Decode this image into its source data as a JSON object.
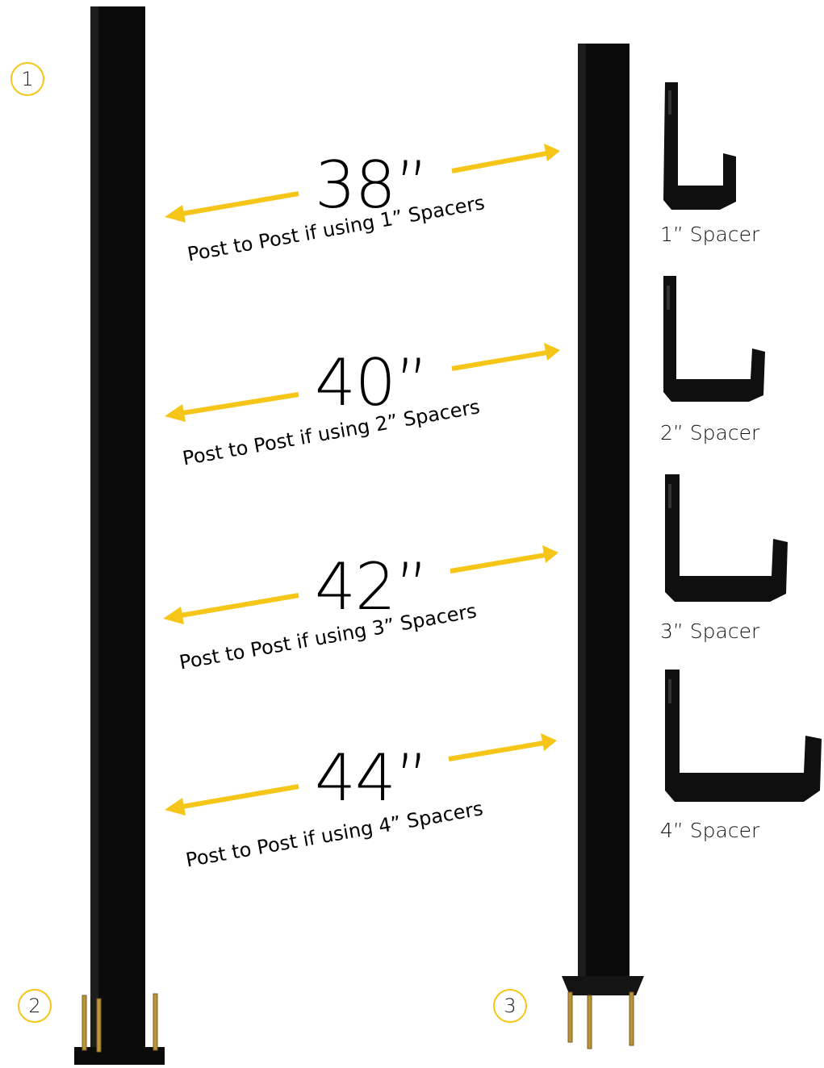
{
  "badges": {
    "b1": "1",
    "b2": "2",
    "b3": "3"
  },
  "measurements": [
    {
      "value": "38”",
      "caption": "Post to Post if using 1” Spacers"
    },
    {
      "value": "40”",
      "caption": "Post to Post if using 2” Spacers"
    },
    {
      "value": "42”",
      "caption": "Post to Post if using 3” Spacers"
    },
    {
      "value": "44”",
      "caption": "Post to Post if using 4” Spacers"
    }
  ],
  "spacers": [
    {
      "label": "1” Spacer"
    },
    {
      "label": "2” Spacer"
    },
    {
      "label": "3” Spacer"
    },
    {
      "label": "4” Spacer"
    }
  ],
  "colors": {
    "accent": "#F5C518",
    "post": "#0b0b0b",
    "screw": "#b8953c"
  }
}
